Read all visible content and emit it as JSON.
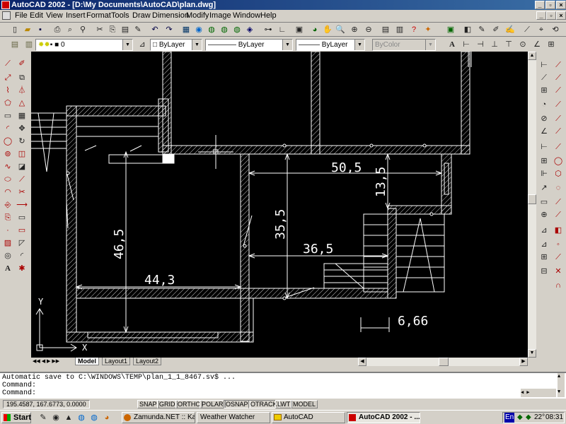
{
  "app": {
    "title": "AutoCAD 2002 - [D:\\My Documents\\AutoCAD\\plan.dwg]"
  },
  "menu": [
    "File",
    "Edit",
    "View",
    "Insert",
    "Format",
    "Tools",
    "Draw",
    "Dimension",
    "Modify",
    "Image",
    "Window",
    "Help"
  ],
  "layer_toolbar": {
    "layer": "0",
    "color": "ByLayer",
    "linetype": "ByLayer",
    "lineweight": "ByLayer",
    "plotstyle": "ByColor"
  },
  "drawing": {
    "dims": [
      "50,5",
      "13,5",
      "35,5",
      "36,5",
      "46,5",
      "44,3",
      "6,66"
    ],
    "ucs_y": "Y",
    "ucs_x": "X"
  },
  "tabs": [
    "Model",
    "Layout1",
    "Layout2"
  ],
  "command_lines": [
    "Automatic save to C:\\WINDOWS\\TEMP\\plan_1_1_8467.sv$ ...",
    "Command:",
    "Command:"
  ],
  "status": {
    "coords": "195.4587, 167.6773, 0.0000",
    "toggles": [
      "SNAP",
      "GRID",
      "ORTHO",
      "POLAR",
      "OSNAP",
      "OTRACK",
      "LWT",
      "MODEL"
    ]
  },
  "taskbar": {
    "start": "Start",
    "tasks": [
      "Zamunda.NET :: Ka...",
      "Weather Watcher",
      "AutoCAD",
      "AutoCAD 2002 - ..."
    ],
    "lang": "En",
    "temp": "22°",
    "clock": "08:31"
  },
  "colors": {
    "titlebar": "#0a246a",
    "canvas": "#000000",
    "linework": "#ffffff"
  }
}
